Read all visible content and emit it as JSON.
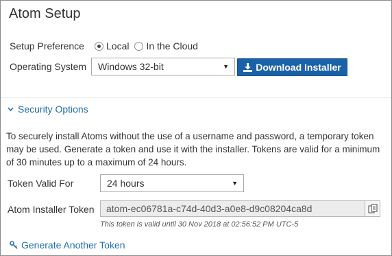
{
  "title": "Atom Setup",
  "setup_preference": {
    "label": "Setup Preference",
    "options": [
      {
        "label": "Local",
        "selected": true
      },
      {
        "label": "In the Cloud",
        "selected": false
      }
    ]
  },
  "operating_system": {
    "label": "Operating System",
    "selected": "Windows 32-bit"
  },
  "download_button": {
    "label": "Download Installer",
    "icon": "download-icon"
  },
  "security": {
    "header": "Security Options",
    "expanded": true,
    "description": "To securely install Atoms without the use of a username and password, a temporary token may be used. Generate a token and use it with the installer. Tokens are valid for a minimum of 30 minutes up to a maximum of 24 hours.",
    "token_valid_for": {
      "label": "Token Valid For",
      "selected": "24 hours"
    },
    "installer_token": {
      "label": "Atom Installer Token",
      "value": "atom-ec06781a-c74d-40d3-a0e8-d9c08204ca8d",
      "note": "This token is valid until 30 Nov 2018 at 02:56:52 PM UTC-5"
    },
    "generate_link": "Generate Another Token"
  },
  "colors": {
    "accent": "#1a62a8",
    "link": "#1f6fae"
  }
}
